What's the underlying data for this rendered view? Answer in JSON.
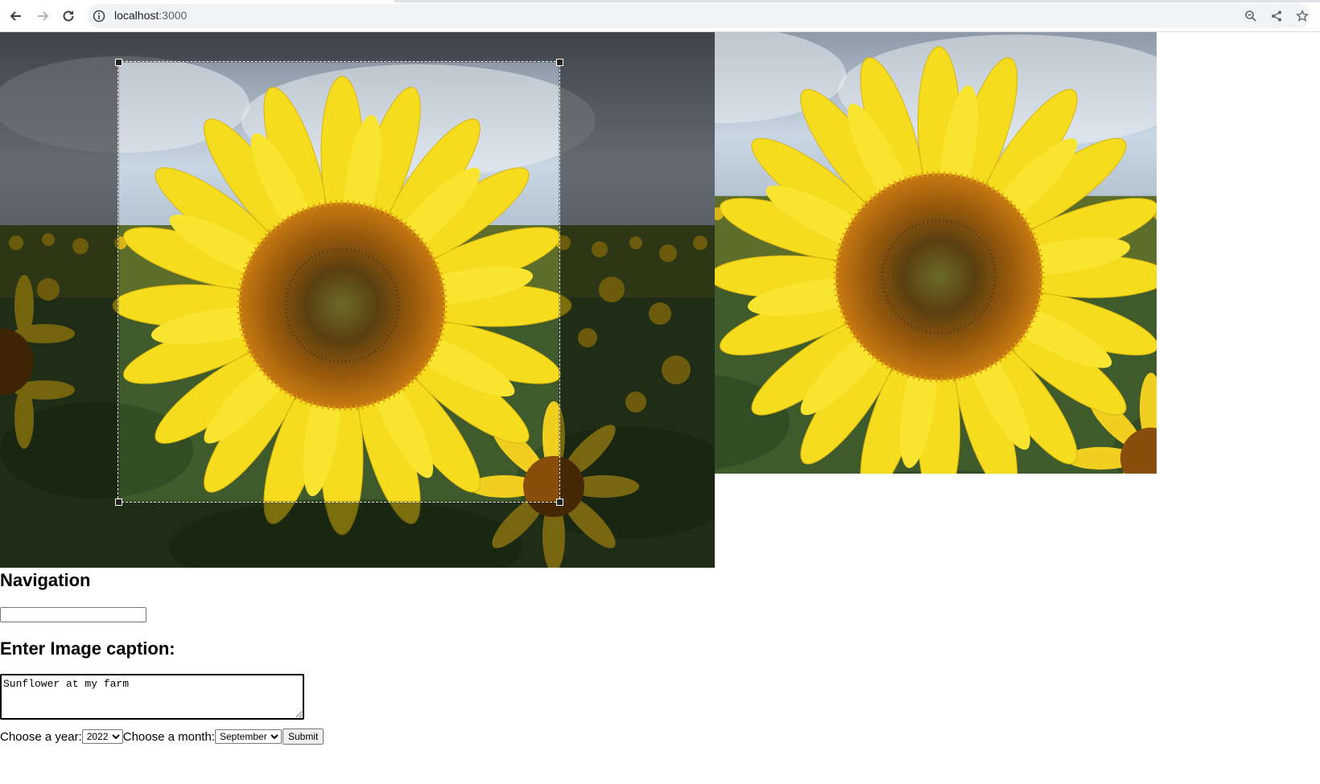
{
  "browser": {
    "url_host": "localhost",
    "url_port": ":3000",
    "icons": [
      "back-arrow-icon",
      "forward-arrow-icon",
      "reload-icon",
      "site-info-icon",
      "zoom-icon",
      "share-icon",
      "bookmark-star-icon"
    ]
  },
  "image": {
    "subject": "Sunflower in a field",
    "colors": {
      "sky": "#c9d6e3",
      "petal": "#f2d81c",
      "disk": "#7a4a0c",
      "foliage": "#3c5a2a"
    }
  },
  "navigation": {
    "heading": "Navigation",
    "input_value": ""
  },
  "caption": {
    "heading": "Enter Image caption:",
    "value": "Sunflower at my farm"
  },
  "form": {
    "year_label": "Choose a year:",
    "year_value": "2022",
    "month_label": "Choose a month:",
    "month_value": "September",
    "submit_label": "Submit"
  }
}
